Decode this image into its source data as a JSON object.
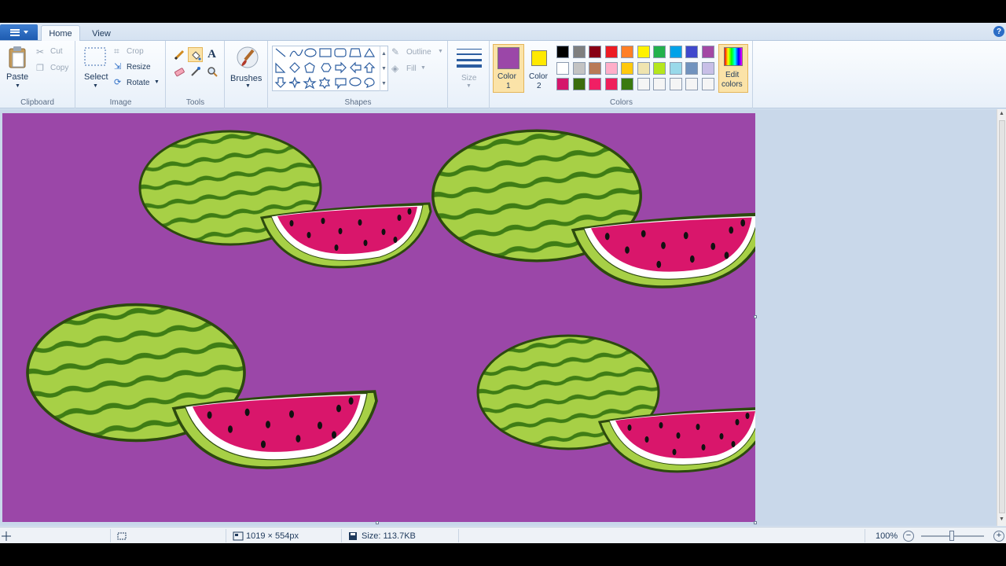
{
  "ribbon": {
    "app_menu": "app-menu",
    "tabs": [
      {
        "label": "Home"
      },
      {
        "label": "View"
      }
    ],
    "help": "?",
    "clipboard": {
      "paste": "Paste",
      "cut": "Cut",
      "copy": "Copy",
      "group_label": "Clipboard"
    },
    "image": {
      "select": "Select",
      "crop": "Crop",
      "resize": "Resize",
      "rotate": "Rotate",
      "group_label": "Image"
    },
    "tools": {
      "group_label": "Tools"
    },
    "brushes": {
      "label": "Brushes"
    },
    "shapes": {
      "outline": "Outline",
      "fill": "Fill",
      "group_label": "Shapes"
    },
    "size": {
      "label": "Size"
    },
    "colors": {
      "color1_label": "Color",
      "color1_num": "1",
      "color2_label": "Color",
      "color2_num": "2",
      "edit_colors": "Edit",
      "edit_colors_2": "colors",
      "group_label": "Colors",
      "color1_value": "#9b47a8",
      "color2_value": "#ffe900",
      "palette": [
        "#000000",
        "#7f7f7f",
        "#880015",
        "#ed1c24",
        "#ff7f27",
        "#fff200",
        "#22b14c",
        "#00a2e8",
        "#3f48cc",
        "#a349a4",
        "#ffffff",
        "#c3c3c3",
        "#b97a57",
        "#ffaec9",
        "#ffc90e",
        "#efe4b0",
        "#b5e61d",
        "#99d9ea",
        "#7092be",
        "#c8bfe7",
        "#d5166b",
        "#3b6d0d",
        "#f01f64",
        "#ef1f5a",
        "#3a7a10",
        "#f5f5f5",
        "#f5f5f5",
        "#f5f5f5",
        "#f5f5f5",
        "#f5f5f5"
      ]
    }
  },
  "status": {
    "dimensions": "1019 × 554px",
    "size": "Size: 113.7KB",
    "zoom": "100%"
  },
  "colors": {
    "canvas_bg": "#9b47a8",
    "accent": "#2c6dc6"
  }
}
